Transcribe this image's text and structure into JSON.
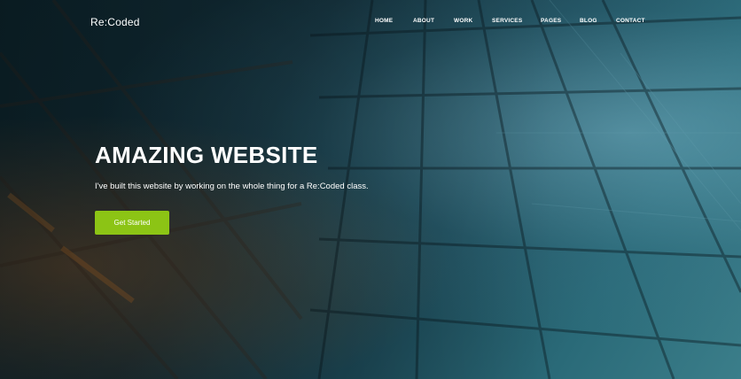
{
  "brand": {
    "name": "Re:Coded"
  },
  "nav": {
    "items": [
      {
        "label": "HOME"
      },
      {
        "label": "ABOUT"
      },
      {
        "label": "WORK"
      },
      {
        "label": "SERVICES"
      },
      {
        "label": "PAGES"
      },
      {
        "label": "BLOG"
      },
      {
        "label": "CONTACT"
      }
    ]
  },
  "hero": {
    "title": "AMAZING WEBSITE",
    "description": "I've built this website by working on the whole thing for a Re:Coded class.",
    "cta_label": "Get Started"
  },
  "colors": {
    "accent": "#8cc415",
    "text": "#ffffff",
    "background_dark": "#0f2a33",
    "background_teal": "#2a6a78"
  },
  "background_image": {
    "icon": "glass-skyscraper-photo"
  }
}
